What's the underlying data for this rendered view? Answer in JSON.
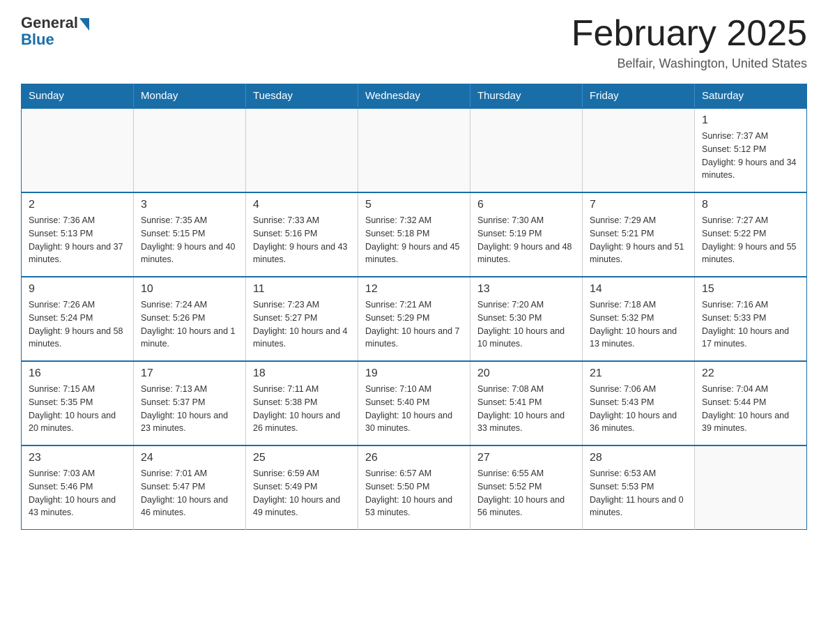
{
  "logo": {
    "general": "General",
    "blue": "Blue"
  },
  "title": "February 2025",
  "location": "Belfair, Washington, United States",
  "weekdays": [
    "Sunday",
    "Monday",
    "Tuesday",
    "Wednesday",
    "Thursday",
    "Friday",
    "Saturday"
  ],
  "weeks": [
    [
      {
        "day": "",
        "info": ""
      },
      {
        "day": "",
        "info": ""
      },
      {
        "day": "",
        "info": ""
      },
      {
        "day": "",
        "info": ""
      },
      {
        "day": "",
        "info": ""
      },
      {
        "day": "",
        "info": ""
      },
      {
        "day": "1",
        "info": "Sunrise: 7:37 AM\nSunset: 5:12 PM\nDaylight: 9 hours and 34 minutes."
      }
    ],
    [
      {
        "day": "2",
        "info": "Sunrise: 7:36 AM\nSunset: 5:13 PM\nDaylight: 9 hours and 37 minutes."
      },
      {
        "day": "3",
        "info": "Sunrise: 7:35 AM\nSunset: 5:15 PM\nDaylight: 9 hours and 40 minutes."
      },
      {
        "day": "4",
        "info": "Sunrise: 7:33 AM\nSunset: 5:16 PM\nDaylight: 9 hours and 43 minutes."
      },
      {
        "day": "5",
        "info": "Sunrise: 7:32 AM\nSunset: 5:18 PM\nDaylight: 9 hours and 45 minutes."
      },
      {
        "day": "6",
        "info": "Sunrise: 7:30 AM\nSunset: 5:19 PM\nDaylight: 9 hours and 48 minutes."
      },
      {
        "day": "7",
        "info": "Sunrise: 7:29 AM\nSunset: 5:21 PM\nDaylight: 9 hours and 51 minutes."
      },
      {
        "day": "8",
        "info": "Sunrise: 7:27 AM\nSunset: 5:22 PM\nDaylight: 9 hours and 55 minutes."
      }
    ],
    [
      {
        "day": "9",
        "info": "Sunrise: 7:26 AM\nSunset: 5:24 PM\nDaylight: 9 hours and 58 minutes."
      },
      {
        "day": "10",
        "info": "Sunrise: 7:24 AM\nSunset: 5:26 PM\nDaylight: 10 hours and 1 minute."
      },
      {
        "day": "11",
        "info": "Sunrise: 7:23 AM\nSunset: 5:27 PM\nDaylight: 10 hours and 4 minutes."
      },
      {
        "day": "12",
        "info": "Sunrise: 7:21 AM\nSunset: 5:29 PM\nDaylight: 10 hours and 7 minutes."
      },
      {
        "day": "13",
        "info": "Sunrise: 7:20 AM\nSunset: 5:30 PM\nDaylight: 10 hours and 10 minutes."
      },
      {
        "day": "14",
        "info": "Sunrise: 7:18 AM\nSunset: 5:32 PM\nDaylight: 10 hours and 13 minutes."
      },
      {
        "day": "15",
        "info": "Sunrise: 7:16 AM\nSunset: 5:33 PM\nDaylight: 10 hours and 17 minutes."
      }
    ],
    [
      {
        "day": "16",
        "info": "Sunrise: 7:15 AM\nSunset: 5:35 PM\nDaylight: 10 hours and 20 minutes."
      },
      {
        "day": "17",
        "info": "Sunrise: 7:13 AM\nSunset: 5:37 PM\nDaylight: 10 hours and 23 minutes."
      },
      {
        "day": "18",
        "info": "Sunrise: 7:11 AM\nSunset: 5:38 PM\nDaylight: 10 hours and 26 minutes."
      },
      {
        "day": "19",
        "info": "Sunrise: 7:10 AM\nSunset: 5:40 PM\nDaylight: 10 hours and 30 minutes."
      },
      {
        "day": "20",
        "info": "Sunrise: 7:08 AM\nSunset: 5:41 PM\nDaylight: 10 hours and 33 minutes."
      },
      {
        "day": "21",
        "info": "Sunrise: 7:06 AM\nSunset: 5:43 PM\nDaylight: 10 hours and 36 minutes."
      },
      {
        "day": "22",
        "info": "Sunrise: 7:04 AM\nSunset: 5:44 PM\nDaylight: 10 hours and 39 minutes."
      }
    ],
    [
      {
        "day": "23",
        "info": "Sunrise: 7:03 AM\nSunset: 5:46 PM\nDaylight: 10 hours and 43 minutes."
      },
      {
        "day": "24",
        "info": "Sunrise: 7:01 AM\nSunset: 5:47 PM\nDaylight: 10 hours and 46 minutes."
      },
      {
        "day": "25",
        "info": "Sunrise: 6:59 AM\nSunset: 5:49 PM\nDaylight: 10 hours and 49 minutes."
      },
      {
        "day": "26",
        "info": "Sunrise: 6:57 AM\nSunset: 5:50 PM\nDaylight: 10 hours and 53 minutes."
      },
      {
        "day": "27",
        "info": "Sunrise: 6:55 AM\nSunset: 5:52 PM\nDaylight: 10 hours and 56 minutes."
      },
      {
        "day": "28",
        "info": "Sunrise: 6:53 AM\nSunset: 5:53 PM\nDaylight: 11 hours and 0 minutes."
      },
      {
        "day": "",
        "info": ""
      }
    ]
  ]
}
